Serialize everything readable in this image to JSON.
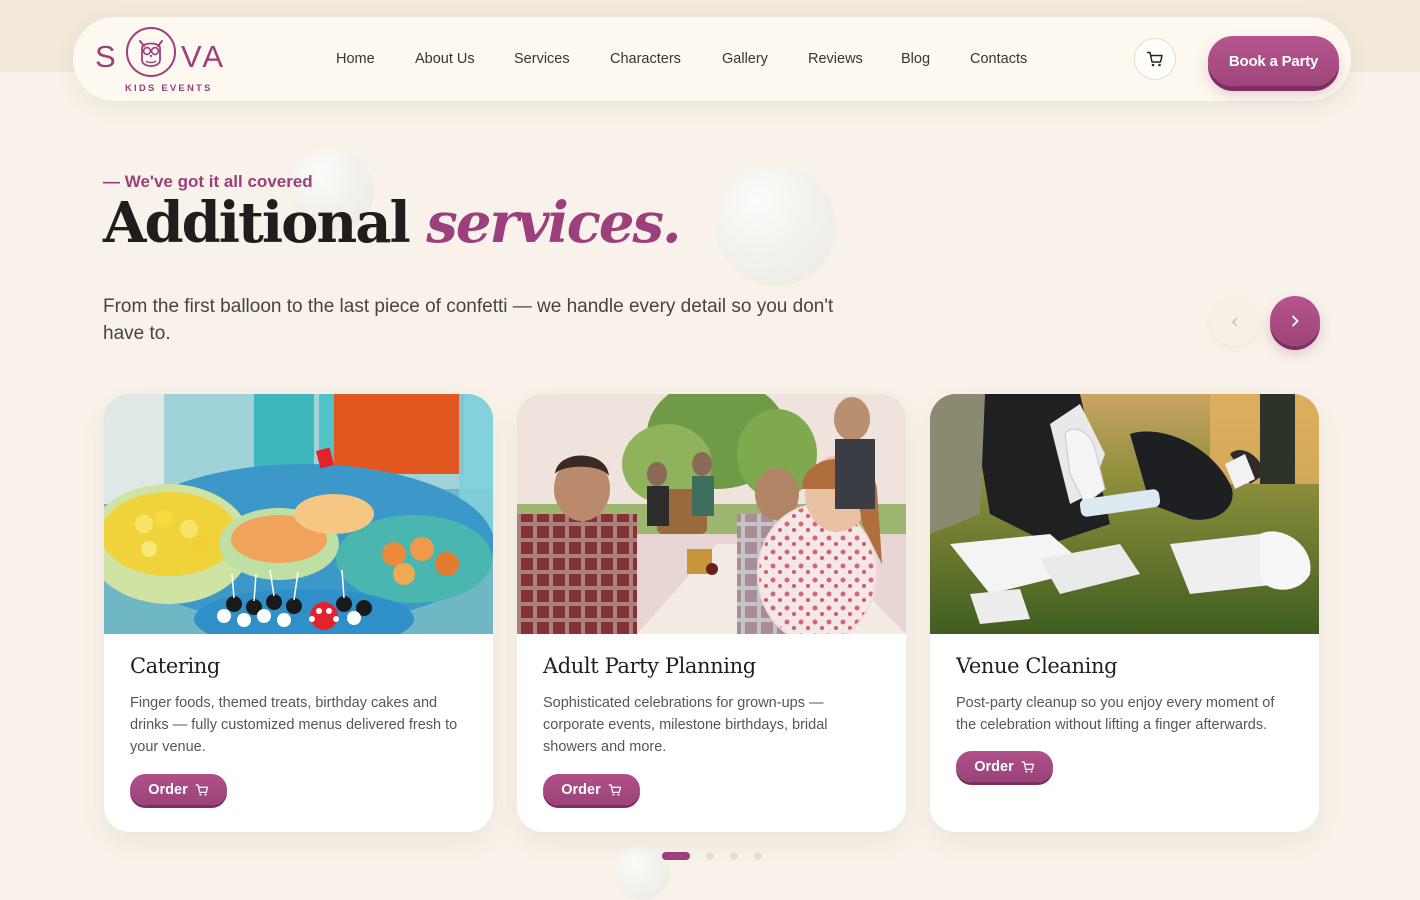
{
  "brand": {
    "logo_left": "S",
    "logo_right": "VA",
    "tagline": "KIDS EVENTS",
    "accent_color": "#9b3f7d"
  },
  "nav": {
    "items": [
      {
        "label": "Home"
      },
      {
        "label": "About Us"
      },
      {
        "label": "Services"
      },
      {
        "label": "Characters"
      },
      {
        "label": "Gallery"
      },
      {
        "label": "Reviews"
      },
      {
        "label": "Blog"
      },
      {
        "label": "Contacts"
      }
    ],
    "cart_icon": "cart-icon",
    "cta_label": "Book a Party"
  },
  "hero": {
    "eyebrow": "— We've got it all covered",
    "headline_plain": "Additional ",
    "headline_accent": "services.",
    "subtitle": "From the first balloon to the last piece of confetti — we handle every detail so you don't have to."
  },
  "carousel": {
    "prev_icon": "chevron-left-icon",
    "next_icon": "chevron-right-icon",
    "page_count": 4,
    "active_page": 1
  },
  "cards": [
    {
      "title": "Catering",
      "description": "Finger foods, themed treats, birthday cakes and drinks — fully customized menus delivered fresh to your venue.",
      "button_label": "Order",
      "image": "party food table photo"
    },
    {
      "title": "Adult Party Planning",
      "description": "Sophisticated celebrations for grown-ups — corporate events, milestone birthdays, bridal showers and more.",
      "button_label": "Order",
      "image": "outdoor adult picnic photo"
    },
    {
      "title": "Venue Cleaning",
      "description": "Post-party cleanup so you enjoy every moment of the celebration without lifting a finger afterwards.",
      "button_label": "Order",
      "image": "gloved hands collecting litter on grass photo"
    }
  ]
}
